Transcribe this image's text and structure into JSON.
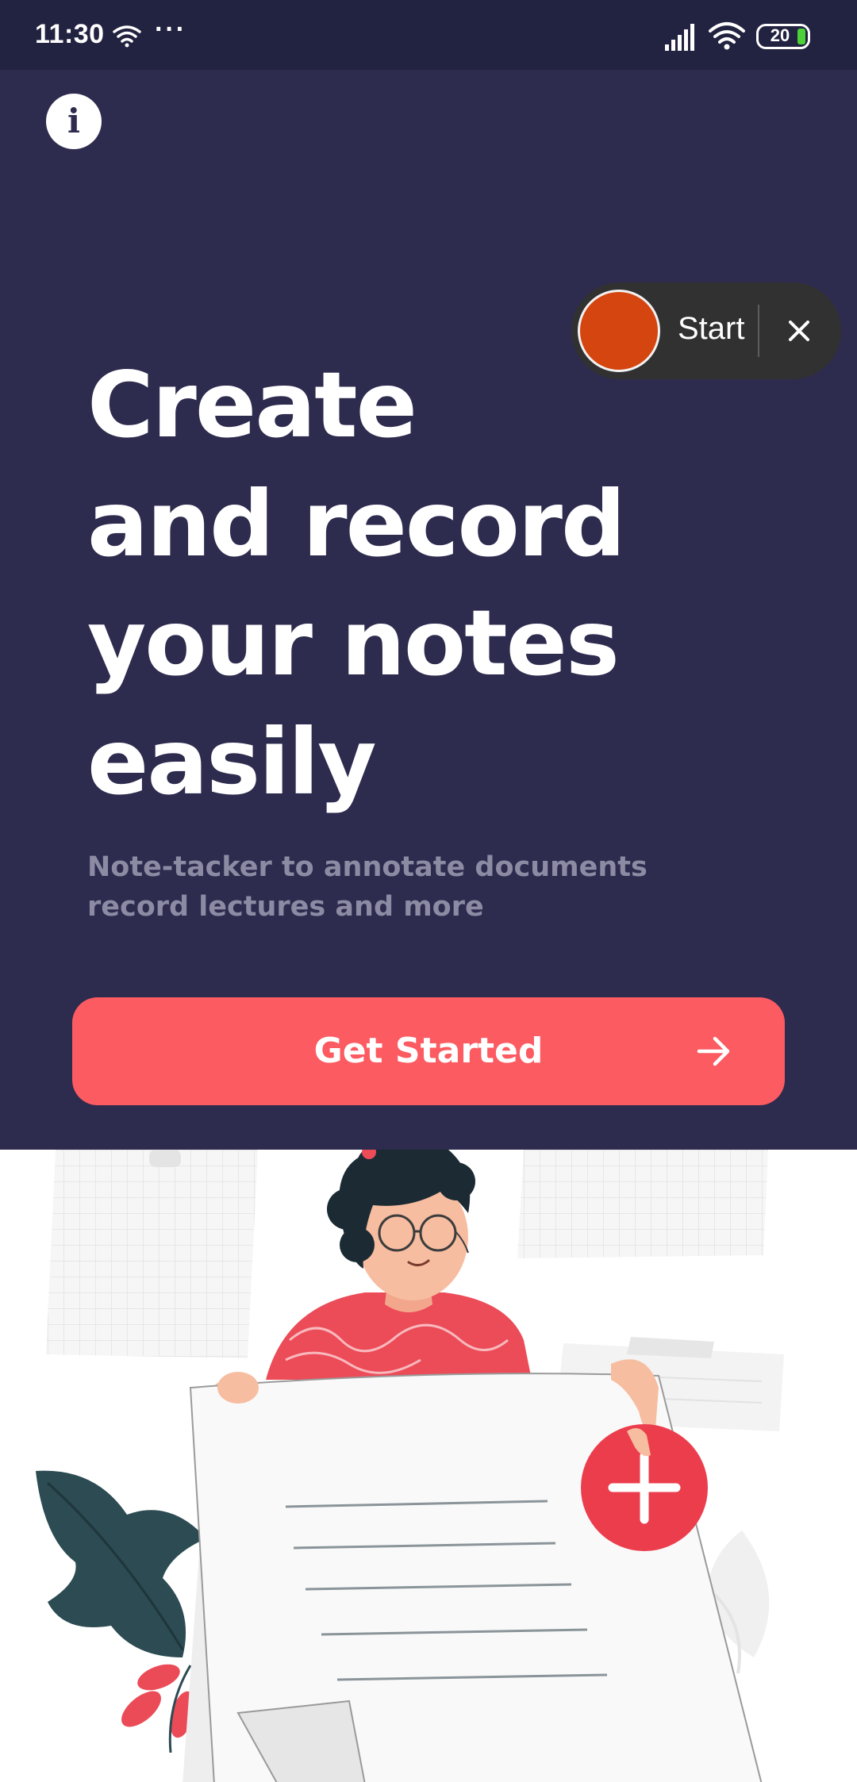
{
  "status_bar": {
    "time": "11:30",
    "more": "···",
    "battery_level": "20",
    "icons": [
      "wifi-small-icon",
      "signal-icon",
      "wifi-icon",
      "battery-icon"
    ]
  },
  "info_button": {
    "icon": "info-icon",
    "glyph": "i"
  },
  "recorder": {
    "start_label": "Start",
    "close_icon": "close-icon",
    "record_color": "#d4450f"
  },
  "hero": {
    "headline_lines": [
      "Create",
      "and record",
      "your notes",
      "easily"
    ],
    "subtitle_lines": [
      "Note-tacker to annotate documents",
      "record lectures and more"
    ],
    "cta_label": "Get Started",
    "cta_icon": "arrow-right-icon"
  },
  "colors": {
    "hero_background": "#2d2b4e",
    "status_background": "#222241",
    "accent": "#fb5b61",
    "subtitle": "#8c8ba3"
  },
  "illustration": {
    "icons": [
      "plus-icon"
    ]
  }
}
